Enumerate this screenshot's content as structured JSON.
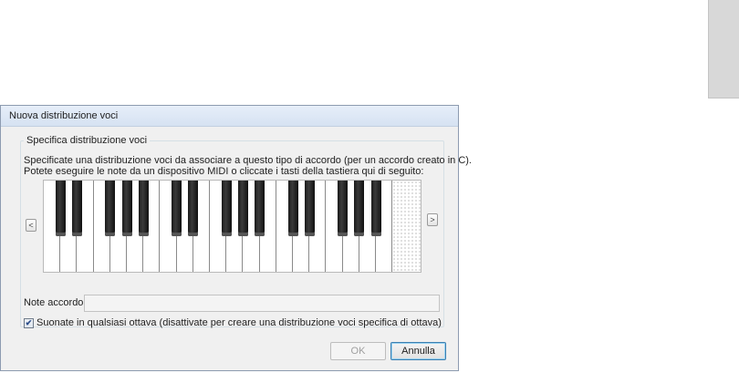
{
  "dialog": {
    "title": "Nuova distribuzione voci",
    "group_label": "Specifica distribuzione voci",
    "description_line1": "Specificate una distribuzione voci da associare a questo tipo di accordo (per un accordo creato in C).",
    "description_line2": "Potete eseguire le note da un dispositivo MIDI o cliccate i tasti della tastiera qui di seguito:",
    "keyboard": {
      "scroll_left": "<",
      "scroll_right": ">",
      "white_key_count": 21,
      "black_keys_per_octave": 5
    },
    "notes_label": "Note accordo:",
    "notes_value": "",
    "any_octave_checkbox": {
      "label": "Suonate in qualsiasi ottava (disattivate per creare una distribuzione voci specifica di ottava)",
      "checked": true,
      "mark": "✔"
    },
    "ok_label": "OK",
    "ok_enabled": false,
    "cancel_label": "Annulla"
  }
}
